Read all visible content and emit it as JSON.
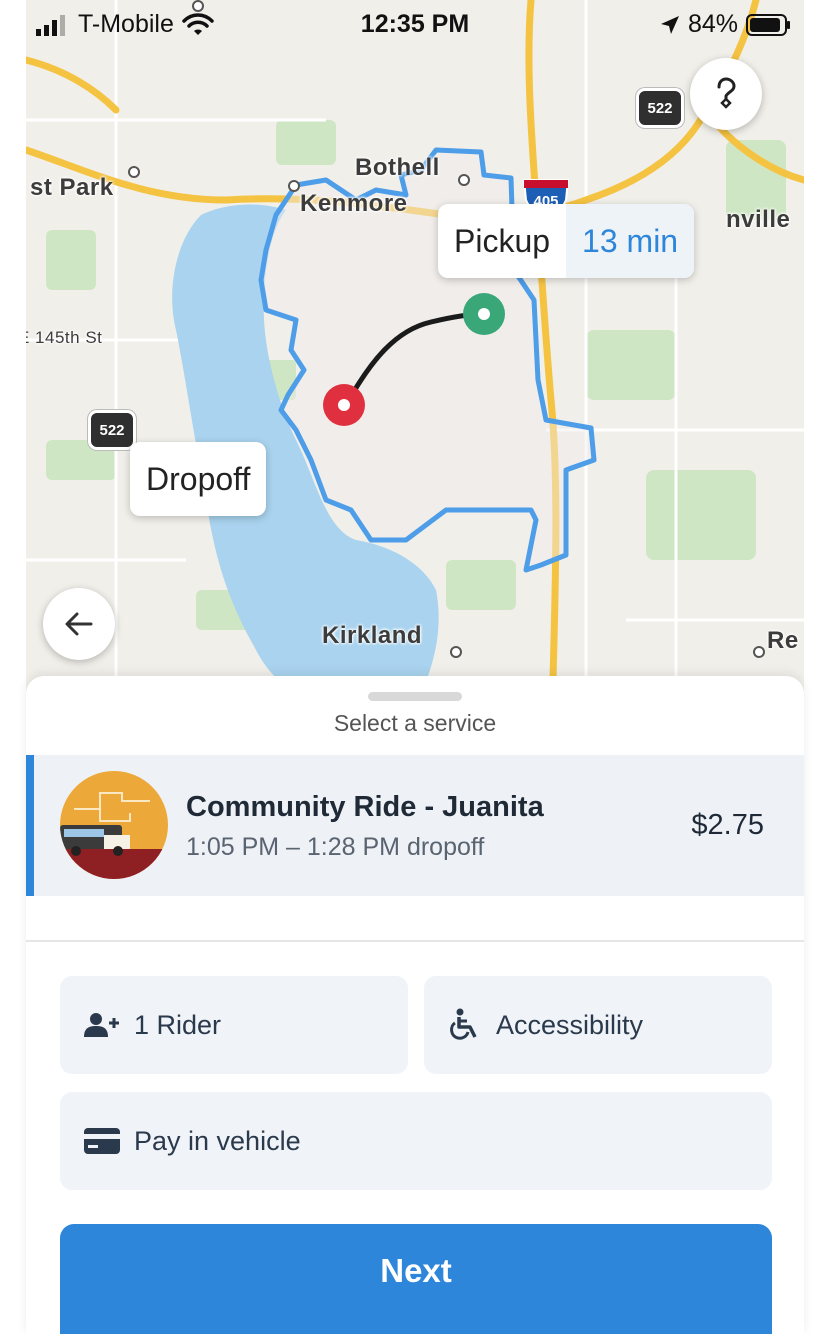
{
  "status_bar": {
    "carrier": "T-Mobile",
    "time": "12:35 PM",
    "battery": "84%"
  },
  "map": {
    "labels": {
      "bothell": "Bothell",
      "kenmore": "Kenmore",
      "park": "st Park",
      "inville": "nville",
      "street_145": "E 145th St",
      "kirkland": "Kirkland",
      "re": "Re"
    },
    "route_522": "522",
    "interstate_405": "405",
    "pickup_tooltip": {
      "label": "Pickup",
      "time": "13 min"
    },
    "dropoff_tooltip": {
      "label": "Dropoff"
    },
    "colors": {
      "water": "#a9d3ee",
      "zone_border": "#4d9de8",
      "highway": "#f5c342",
      "pickup_pin": "#3aa779",
      "dropoff_pin": "#e0303f"
    },
    "icons": {
      "help": "question-mark-icon",
      "back": "arrow-left-icon"
    }
  },
  "sheet": {
    "title": "Select a service",
    "service": {
      "name": "Community Ride - Juanita",
      "time_window": "1:05 PM – 1:28 PM dropoff",
      "price": "$2.75"
    },
    "options": {
      "riders": "1 Rider",
      "accessibility": "Accessibility",
      "payment": "Pay in vehicle"
    },
    "next_label": "Next",
    "colors": {
      "accent": "#2d86d9"
    }
  }
}
